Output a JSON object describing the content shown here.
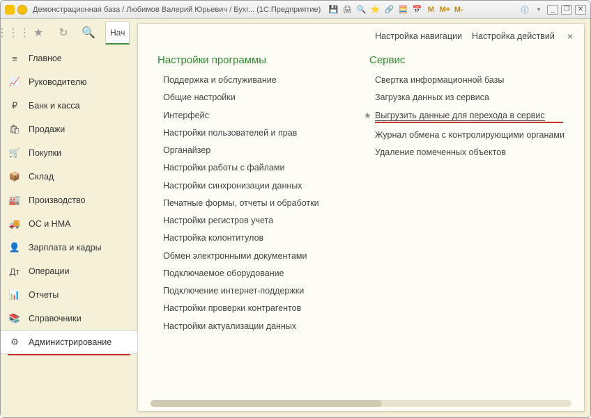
{
  "titlebar": {
    "title": "Демонстрационная база / Любимов Валерий Юрьевич / Бухг...   (1С:Предприятие)",
    "win_min": "_",
    "win_max": "❐",
    "win_close": "✕",
    "m_btn1": "M",
    "m_btn2": "M+",
    "m_btn3": "M-"
  },
  "top_tab": "Нач",
  "sidebar": {
    "items": [
      {
        "icon": "menu-icon",
        "label": "Главное"
      },
      {
        "icon": "chart-icon",
        "label": "Руководителю"
      },
      {
        "icon": "ruble-icon",
        "label": "Банк и касса"
      },
      {
        "icon": "bag-icon",
        "label": "Продажи"
      },
      {
        "icon": "cart-icon",
        "label": "Покупки"
      },
      {
        "icon": "box-icon",
        "label": "Склад"
      },
      {
        "icon": "factory-icon",
        "label": "Производство"
      },
      {
        "icon": "truck-icon",
        "label": "ОС и НМА"
      },
      {
        "icon": "person-icon",
        "label": "Зарплата и кадры"
      },
      {
        "icon": "ops-icon",
        "label": "Операции"
      },
      {
        "icon": "report-icon",
        "label": "Отчеты"
      },
      {
        "icon": "book-icon",
        "label": "Справочники"
      },
      {
        "icon": "gear-icon",
        "label": "Администрирование"
      }
    ]
  },
  "header": {
    "nav_settings": "Настройка навигации",
    "action_settings": "Настройка действий",
    "close": "×"
  },
  "columns": {
    "left": {
      "title": "Настройки программы",
      "links": [
        "Поддержка и обслуживание",
        "Общие настройки",
        "Интерфейс",
        "Настройки пользователей и прав",
        "Органайзер",
        "Настройки работы с файлами",
        "Настройки синхронизации данных",
        "Печатные формы, отчеты и обработки",
        "Настройки регистров учета",
        "Настройка колонтитулов",
        "Обмен электронными документами",
        "Подключаемое оборудование",
        "Подключение интернет-поддержки",
        "Настройки проверки контрагентов",
        "Настройки актуализации данных"
      ]
    },
    "right": {
      "title": "Сервис",
      "links": [
        "Свертка информационной базы",
        "Загрузка данных из сервиса",
        "Выгрузить данные для перехода в сервис",
        "Журнал обмена с контролирующими органами",
        "Удаление помеченных объектов"
      ],
      "highlighted_index": 2
    }
  }
}
